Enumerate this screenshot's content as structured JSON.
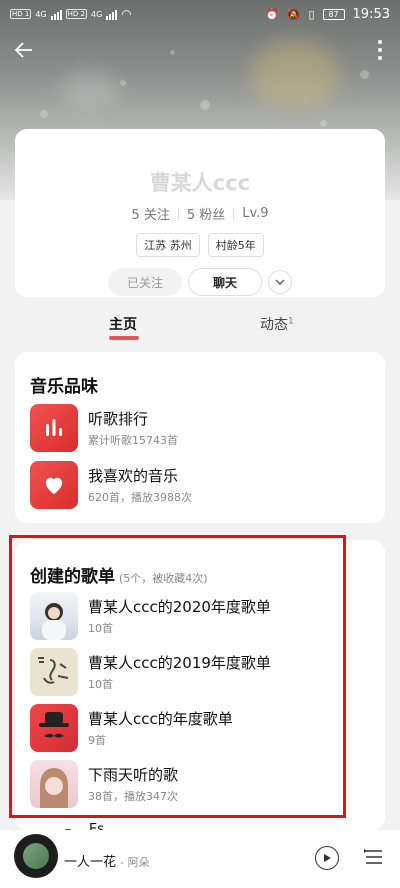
{
  "status_bar": {
    "hd1": "HD 1",
    "net1": "4G",
    "hd2": "HD 2",
    "net2": "4G",
    "battery": "87",
    "time": "19:53"
  },
  "profile": {
    "name": "曹某人ccc",
    "following": "5 关注",
    "followers": "5 粉丝",
    "level": "Lv.9",
    "tags": [
      "江苏 苏州",
      "村龄5年"
    ],
    "followed_label": "已关注",
    "chat_label": "聊天"
  },
  "tabs": {
    "home": "主页",
    "activity": "动态",
    "activity_badge": "1"
  },
  "music_taste": {
    "title": "音乐品味",
    "items": [
      {
        "title": "听歌排行",
        "sub": "累计听歌15743首",
        "icon": "bar-chart-icon"
      },
      {
        "title": "我喜欢的音乐",
        "sub": "620首，播放3988次",
        "icon": "heart-icon"
      }
    ]
  },
  "created_playlists": {
    "title": "创建的歌单",
    "count": "(5个，被收藏4次)",
    "items": [
      {
        "title": "曹某人ccc的2020年度歌单",
        "sub": "10首"
      },
      {
        "title": "曹某人ccc的2019年度歌单",
        "sub": "10首"
      },
      {
        "title": "曹某人ccc的年度歌单",
        "sub": "9首"
      },
      {
        "title": "下雨天听的歌",
        "sub": "38首，播放347次"
      }
    ],
    "peek_text": "Es"
  },
  "player": {
    "song": "一人一花",
    "artist": "- 阿朵"
  },
  "colors": {
    "accent_red": "#e4393c",
    "highlight_red": "#d9141c"
  }
}
